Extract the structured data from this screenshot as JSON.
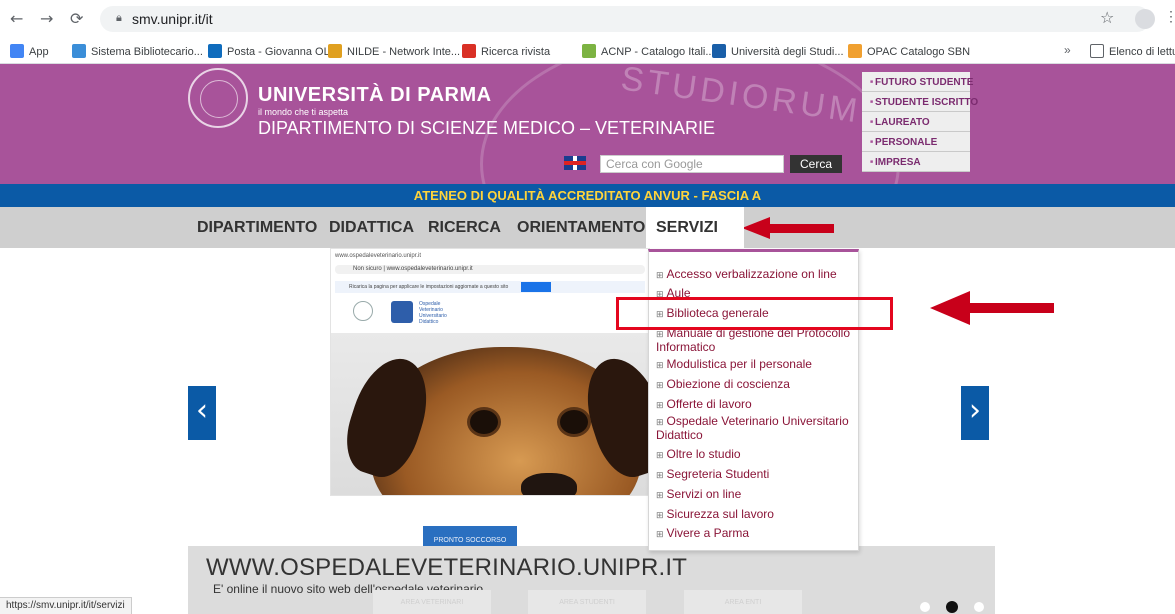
{
  "browser": {
    "back_icon": "back-arrow-icon",
    "forward_icon": "forward-arrow-icon",
    "reload_icon": "reload-icon",
    "url": "smv.unipr.it/it",
    "bookmarks": [
      {
        "label": "App",
        "color": "#4285f4"
      },
      {
        "label": "Sistema Bibliotecario...",
        "color": "#3b8ed8"
      },
      {
        "label": "Posta - Giovanna OLI...",
        "color": "#0f6cbd"
      },
      {
        "label": "NILDE - Network Inte...",
        "color": "#e0a020"
      },
      {
        "label": "Ricerca rivista",
        "color": "#d93025"
      },
      {
        "label": "ACNP - Catalogo Itali...",
        "color": "#7cb342"
      },
      {
        "label": "Università degli Studi...",
        "color": "#1a5fa8"
      },
      {
        "label": "OPAC Catalogo SBN",
        "color": "#f0a030"
      }
    ],
    "more": "»",
    "reading_list": "Elenco di lettura",
    "status_url": "https://smv.unipr.it/it/servizi"
  },
  "header": {
    "university": "UNIVERSITÀ DI PARMA",
    "tagline": "il mondo che ti aspetta",
    "department": "DIPARTIMENTO DI SCIENZE MEDICO – VETERINARIE",
    "watermark": "STUDIORUM",
    "search_placeholder": "Cerca con Google",
    "search_button": "Cerca",
    "brand_color": "#a8539a",
    "quick_links": [
      "FUTURO STUDENTE",
      "STUDENTE ISCRITTO",
      "LAUREATO",
      "PERSONALE",
      "IMPRESA"
    ]
  },
  "banner": {
    "text": "ATENEO DI QUALITÀ ACCREDITATO ANVUR - FASCIA A",
    "bg": "#0b5aa6",
    "fg": "#ffd43b"
  },
  "nav": {
    "items": [
      "DIPARTIMENTO",
      "DIDATTICA",
      "RICERCA",
      "ORIENTAMENTO",
      "SERVIZI"
    ],
    "active": "SERVIZI"
  },
  "servizi_menu": [
    "Accesso verbalizzazione on line",
    "Aule",
    "Biblioteca generale",
    "Manuale di gestione del Protocollo Informatico",
    "Modulistica per il personale",
    "Obiezione di coscienza",
    "Offerte di lavoro",
    "Ospedale Veterinario Universitario Didattico",
    "Oltre lo studio",
    "Segreteria Studenti",
    "Servizi on line",
    "Sicurezza sul lavoro",
    "Vivere a Parma"
  ],
  "slider": {
    "mini_tab": "www.ospedaleveterinario.unipr.it",
    "mini_url": "Non sicuro | www.ospedaleveterinario.unipr.it",
    "mini_note": "Ricarica la pagina per applicare le impostazioni aggiornate a questo sito",
    "mini_caption": "Ospedale Veterinario Universitario Didattico",
    "title": "WWW.OSPEDALEVETERINARIO.UNIPR.IT",
    "subtitle": "E' online il nuovo sito web dell'ospedale veterinario",
    "pronto": "PRONTO SOCCORSO",
    "areas": [
      "AREA VETERINARI",
      "AREA STUDENTI",
      "AREA ENTI"
    ],
    "prev_icon": "chevron-left-icon",
    "next_icon": "chevron-right-icon"
  }
}
